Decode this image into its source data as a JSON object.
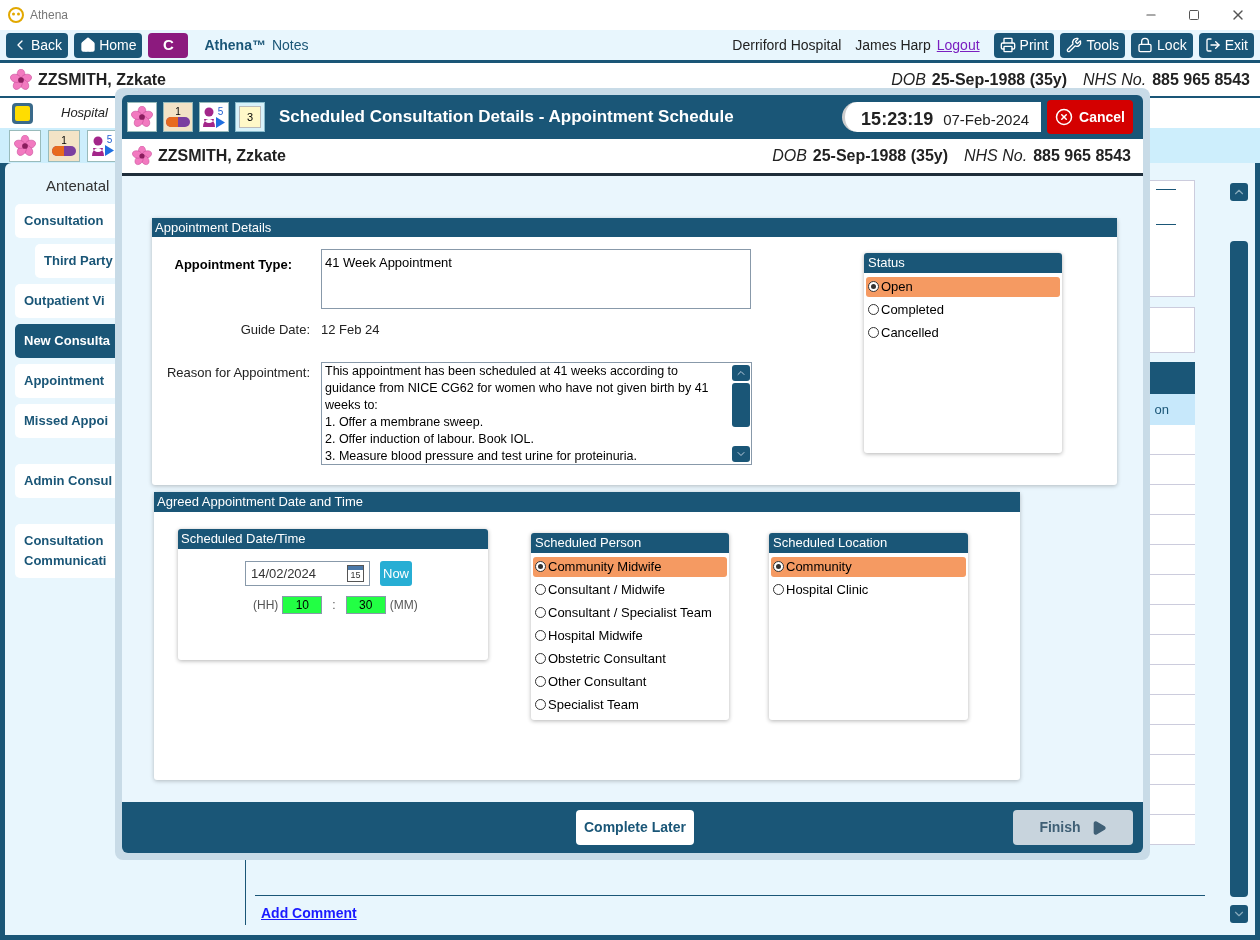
{
  "window": {
    "title": "Athena"
  },
  "toolbar": {
    "nav": [
      {
        "kind": "back",
        "label": "Back"
      },
      {
        "kind": "home",
        "label": "Home"
      }
    ],
    "c_button": "C",
    "brand": "Athena™",
    "section": "Notes",
    "hospital": "Derriford Hospital",
    "user": "James Harp",
    "logout": "Logout",
    "actions": [
      {
        "kind": "print",
        "label": "Print"
      },
      {
        "kind": "tools",
        "label": "Tools"
      },
      {
        "kind": "lock",
        "label": "Lock"
      },
      {
        "kind": "exit",
        "label": "Exit"
      }
    ]
  },
  "patient": {
    "name": "ZZSMITH, Zzkate",
    "dob_label": "DOB",
    "dob": "25-Sep-1988 (35y)",
    "nhs_label": "NHS No.",
    "nhs": "885 965 8543"
  },
  "location_bar": {
    "text": "Hospital"
  },
  "icon_bar": [
    {
      "kind": "flower"
    },
    {
      "kind": "pill",
      "badge": "1"
    },
    {
      "kind": "person",
      "badge": "5"
    }
  ],
  "sidebar": {
    "heading": "Antenatal",
    "groups": [
      {
        "items": [
          {
            "label": "Consultation",
            "selected": false,
            "children": [
              {
                "label": "Third Party",
                "selected": false
              }
            ]
          },
          {
            "label": "Outpatient Vi",
            "selected": false
          },
          {
            "label": "New Consulta",
            "selected": true
          },
          {
            "label": "Appointment",
            "selected": false
          },
          {
            "label": "Missed Appoi",
            "selected": false
          }
        ]
      },
      {
        "items": [
          {
            "label": "Admin Consul",
            "selected": false
          }
        ]
      },
      {
        "items": [
          {
            "label": "Consultation\nCommunicati",
            "selected": false
          }
        ]
      }
    ]
  },
  "right_panel": {
    "column_header": "on"
  },
  "add_comment": "Add Comment",
  "dialog": {
    "icons": [
      {
        "kind": "flower"
      },
      {
        "kind": "pill",
        "badge": "1"
      },
      {
        "kind": "person",
        "badge": "5"
      },
      {
        "kind": "notepad",
        "badge": "3"
      }
    ],
    "title": "Scheduled Consultation Details - Appointment Schedule",
    "time": "15:23:19",
    "date": "07-Feb-2024",
    "cancel": "Cancel",
    "patient": {
      "name": "ZZSMITH, Zzkate",
      "dob_label": "DOB",
      "dob": "25-Sep-1988 (35y)",
      "nhs_label": "NHS No.",
      "nhs": "885 965 8543"
    },
    "appointment_details": {
      "title": "Appointment Details",
      "type_label": "Appointment Type:",
      "type_value": "41 Week Appointment",
      "guide_label": "Guide Date:",
      "guide_value": "12 Feb 24",
      "reason_label": "Reason for Appointment:",
      "reason_value": "This appointment has been scheduled at 41 weeks according to guidance from NICE CG62 for women who have not given birth by 41 weeks to:\n1. Offer a membrane sweep.\n2. Offer induction of labour. Book IOL.\n3. Measure blood pressure and test urine for proteinuria."
    },
    "status": {
      "title": "Status",
      "options": [
        {
          "label": "Open",
          "selected": true
        },
        {
          "label": "Completed",
          "selected": false
        },
        {
          "label": "Cancelled",
          "selected": false
        }
      ]
    },
    "agreed": {
      "title": "Agreed Appointment Date and Time",
      "datetime": {
        "title": "Scheduled Date/Time",
        "date": "14/02/2024",
        "calendar_day": "15",
        "now": "Now",
        "hh_label": "(HH)",
        "hour": "10",
        "separator": ":",
        "minute": "30",
        "mm_label": "(MM)"
      },
      "person": {
        "title": "Scheduled Person",
        "options": [
          {
            "label": "Community Midwife",
            "selected": true
          },
          {
            "label": "Consultant / Midwife",
            "selected": false
          },
          {
            "label": "Consultant / Specialist Team",
            "selected": false
          },
          {
            "label": "Hospital Midwife",
            "selected": false
          },
          {
            "label": "Obstetric Consultant",
            "selected": false
          },
          {
            "label": "Other Consultant",
            "selected": false
          },
          {
            "label": "Specialist Team",
            "selected": false
          }
        ]
      },
      "location": {
        "title": "Scheduled Location",
        "options": [
          {
            "label": "Community",
            "selected": true
          },
          {
            "label": "Hospital Clinic",
            "selected": false
          }
        ]
      }
    },
    "footer": {
      "complete_later": "Complete Later",
      "finish": {
        "label": "Finish",
        "disabled": true
      }
    }
  }
}
